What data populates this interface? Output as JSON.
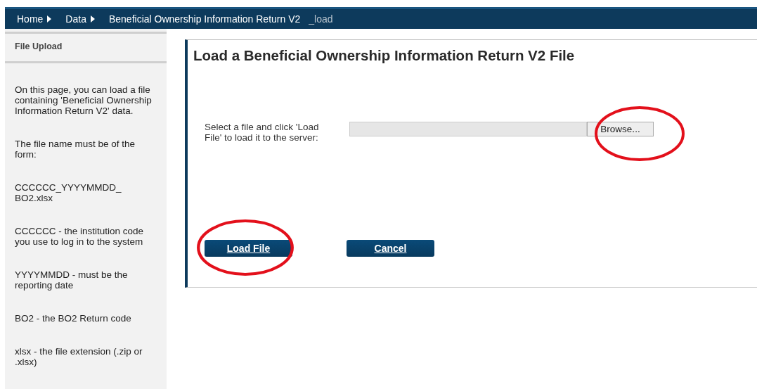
{
  "breadcrumb": {
    "items": [
      {
        "label": "Home"
      },
      {
        "label": "Data"
      }
    ],
    "current": "Beneficial Ownership Information Return V2",
    "suffix": "_load"
  },
  "sidebar": {
    "title": "File Upload",
    "paragraphs": [
      "On this page, you can load a file containing 'Beneficial Ownership Information Return V2' data.",
      "The file name must be of the form:",
      "CCCCCC_YYYYMMDD_ BO2.xlsx",
      "CCCCCC - the institution code you use to log in to the system",
      "YYYYMMDD - must be the reporting date",
      "BO2 - the BO2 Return code",
      "xlsx - the file extension (.zip or .xlsx)"
    ]
  },
  "main": {
    "title": "Load a Beneficial Ownership Information Return V2 File",
    "file_label": "Select a file and click 'Load File' to load it to the server:",
    "browse": {
      "label": "Browse...",
      "highlighted": true
    },
    "buttons": [
      {
        "label": "Load File",
        "highlighted": true
      },
      {
        "label": "Cancel",
        "highlighted": false
      }
    ]
  }
}
